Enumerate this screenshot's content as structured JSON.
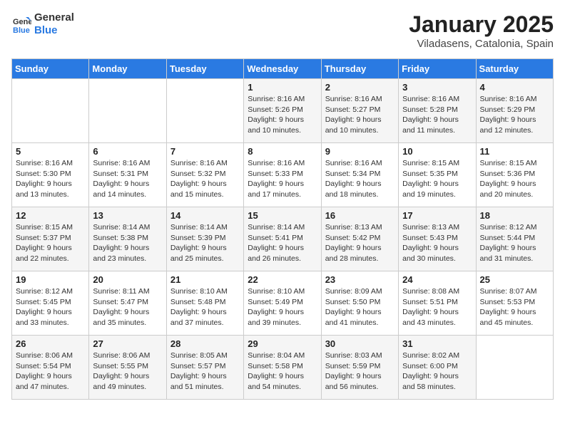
{
  "logo": {
    "line1": "General",
    "line2": "Blue"
  },
  "title": "January 2025",
  "subtitle": "Viladasens, Catalonia, Spain",
  "headers": [
    "Sunday",
    "Monday",
    "Tuesday",
    "Wednesday",
    "Thursday",
    "Friday",
    "Saturday"
  ],
  "weeks": [
    [
      {
        "day": "",
        "info": ""
      },
      {
        "day": "",
        "info": ""
      },
      {
        "day": "",
        "info": ""
      },
      {
        "day": "1",
        "info": "Sunrise: 8:16 AM\nSunset: 5:26 PM\nDaylight: 9 hours\nand 10 minutes."
      },
      {
        "day": "2",
        "info": "Sunrise: 8:16 AM\nSunset: 5:27 PM\nDaylight: 9 hours\nand 10 minutes."
      },
      {
        "day": "3",
        "info": "Sunrise: 8:16 AM\nSunset: 5:28 PM\nDaylight: 9 hours\nand 11 minutes."
      },
      {
        "day": "4",
        "info": "Sunrise: 8:16 AM\nSunset: 5:29 PM\nDaylight: 9 hours\nand 12 minutes."
      }
    ],
    [
      {
        "day": "5",
        "info": "Sunrise: 8:16 AM\nSunset: 5:30 PM\nDaylight: 9 hours\nand 13 minutes."
      },
      {
        "day": "6",
        "info": "Sunrise: 8:16 AM\nSunset: 5:31 PM\nDaylight: 9 hours\nand 14 minutes."
      },
      {
        "day": "7",
        "info": "Sunrise: 8:16 AM\nSunset: 5:32 PM\nDaylight: 9 hours\nand 15 minutes."
      },
      {
        "day": "8",
        "info": "Sunrise: 8:16 AM\nSunset: 5:33 PM\nDaylight: 9 hours\nand 17 minutes."
      },
      {
        "day": "9",
        "info": "Sunrise: 8:16 AM\nSunset: 5:34 PM\nDaylight: 9 hours\nand 18 minutes."
      },
      {
        "day": "10",
        "info": "Sunrise: 8:15 AM\nSunset: 5:35 PM\nDaylight: 9 hours\nand 19 minutes."
      },
      {
        "day": "11",
        "info": "Sunrise: 8:15 AM\nSunset: 5:36 PM\nDaylight: 9 hours\nand 20 minutes."
      }
    ],
    [
      {
        "day": "12",
        "info": "Sunrise: 8:15 AM\nSunset: 5:37 PM\nDaylight: 9 hours\nand 22 minutes."
      },
      {
        "day": "13",
        "info": "Sunrise: 8:14 AM\nSunset: 5:38 PM\nDaylight: 9 hours\nand 23 minutes."
      },
      {
        "day": "14",
        "info": "Sunrise: 8:14 AM\nSunset: 5:39 PM\nDaylight: 9 hours\nand 25 minutes."
      },
      {
        "day": "15",
        "info": "Sunrise: 8:14 AM\nSunset: 5:41 PM\nDaylight: 9 hours\nand 26 minutes."
      },
      {
        "day": "16",
        "info": "Sunrise: 8:13 AM\nSunset: 5:42 PM\nDaylight: 9 hours\nand 28 minutes."
      },
      {
        "day": "17",
        "info": "Sunrise: 8:13 AM\nSunset: 5:43 PM\nDaylight: 9 hours\nand 30 minutes."
      },
      {
        "day": "18",
        "info": "Sunrise: 8:12 AM\nSunset: 5:44 PM\nDaylight: 9 hours\nand 31 minutes."
      }
    ],
    [
      {
        "day": "19",
        "info": "Sunrise: 8:12 AM\nSunset: 5:45 PM\nDaylight: 9 hours\nand 33 minutes."
      },
      {
        "day": "20",
        "info": "Sunrise: 8:11 AM\nSunset: 5:47 PM\nDaylight: 9 hours\nand 35 minutes."
      },
      {
        "day": "21",
        "info": "Sunrise: 8:10 AM\nSunset: 5:48 PM\nDaylight: 9 hours\nand 37 minutes."
      },
      {
        "day": "22",
        "info": "Sunrise: 8:10 AM\nSunset: 5:49 PM\nDaylight: 9 hours\nand 39 minutes."
      },
      {
        "day": "23",
        "info": "Sunrise: 8:09 AM\nSunset: 5:50 PM\nDaylight: 9 hours\nand 41 minutes."
      },
      {
        "day": "24",
        "info": "Sunrise: 8:08 AM\nSunset: 5:51 PM\nDaylight: 9 hours\nand 43 minutes."
      },
      {
        "day": "25",
        "info": "Sunrise: 8:07 AM\nSunset: 5:53 PM\nDaylight: 9 hours\nand 45 minutes."
      }
    ],
    [
      {
        "day": "26",
        "info": "Sunrise: 8:06 AM\nSunset: 5:54 PM\nDaylight: 9 hours\nand 47 minutes."
      },
      {
        "day": "27",
        "info": "Sunrise: 8:06 AM\nSunset: 5:55 PM\nDaylight: 9 hours\nand 49 minutes."
      },
      {
        "day": "28",
        "info": "Sunrise: 8:05 AM\nSunset: 5:57 PM\nDaylight: 9 hours\nand 51 minutes."
      },
      {
        "day": "29",
        "info": "Sunrise: 8:04 AM\nSunset: 5:58 PM\nDaylight: 9 hours\nand 54 minutes."
      },
      {
        "day": "30",
        "info": "Sunrise: 8:03 AM\nSunset: 5:59 PM\nDaylight: 9 hours\nand 56 minutes."
      },
      {
        "day": "31",
        "info": "Sunrise: 8:02 AM\nSunset: 6:00 PM\nDaylight: 9 hours\nand 58 minutes."
      },
      {
        "day": "",
        "info": ""
      }
    ]
  ]
}
